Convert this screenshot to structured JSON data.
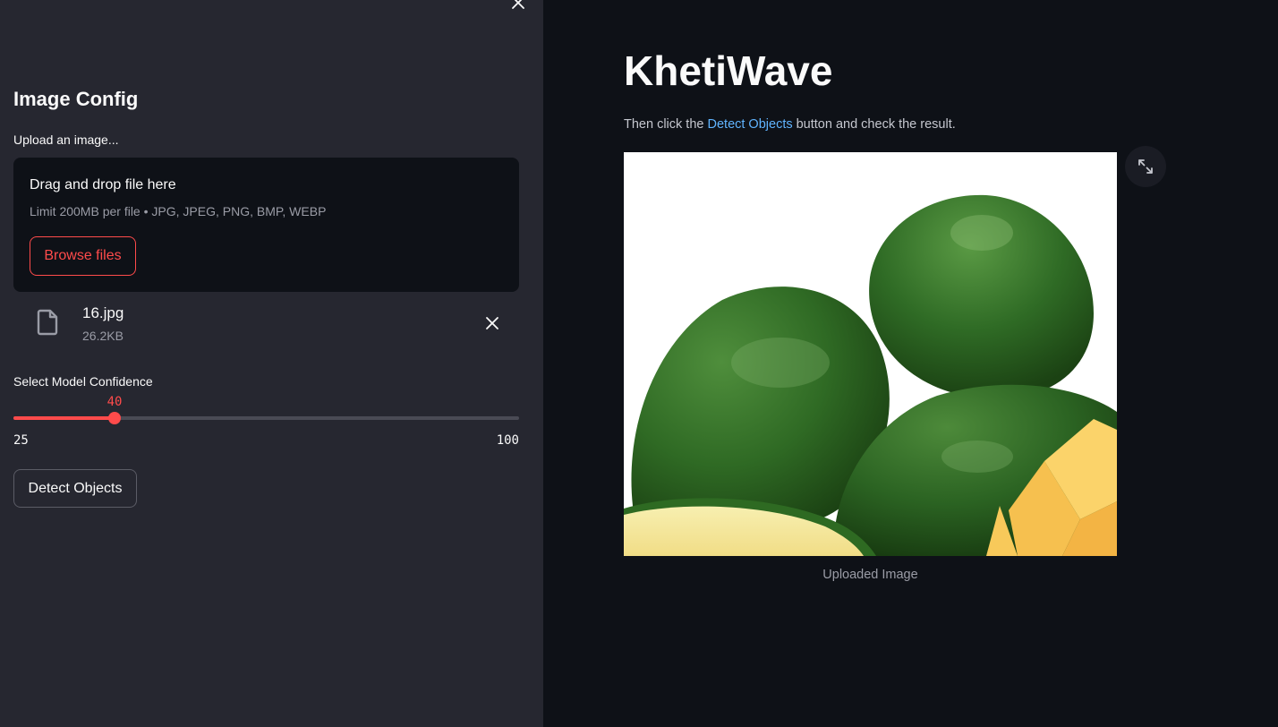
{
  "sidebar": {
    "title": "Image Config",
    "upload_label": "Upload an image...",
    "dropzone": {
      "title": "Drag and drop file here",
      "limit": "Limit 200MB per file • JPG, JPEG, PNG, BMP, WEBP",
      "browse_label": "Browse files"
    },
    "file": {
      "name": "16.jpg",
      "size": "26.2KB"
    },
    "slider": {
      "label": "Select Model Confidence",
      "value": "40",
      "min": "25",
      "max": "100"
    },
    "detect_label": "Detect Objects"
  },
  "main": {
    "title": "KhetiWave",
    "instruction_prefix": "Then click the ",
    "instruction_link": "Detect Objects",
    "instruction_suffix": " button and check the result.",
    "image_caption": "Uploaded Image"
  },
  "colors": {
    "accent": "#ff4b4b",
    "link": "#60b4ff",
    "sidebar_bg": "#262730",
    "main_bg": "#0e1117"
  },
  "icons": {
    "sidebar_close": "close-icon",
    "file": "file-icon",
    "file_remove": "close-icon",
    "expand": "fullscreen-icon"
  }
}
